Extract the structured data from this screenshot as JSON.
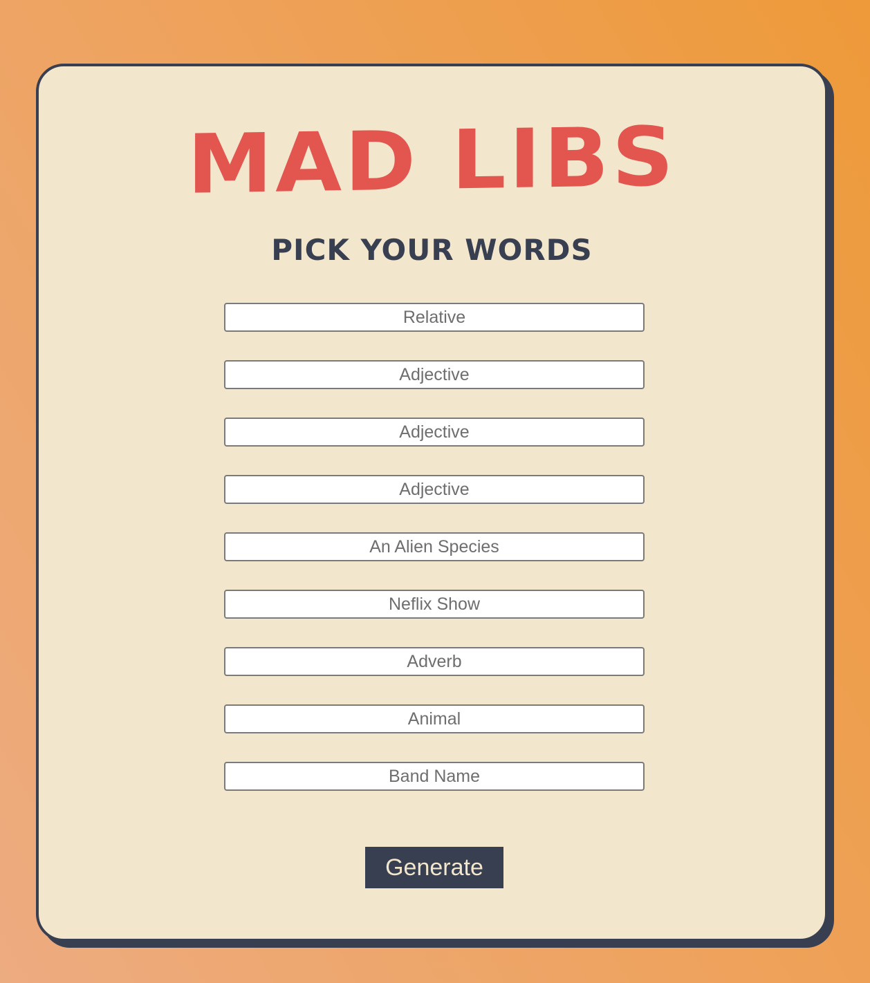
{
  "header": {
    "title": "MAD LIBS",
    "subtitle": "PICK YOUR WORDS"
  },
  "form": {
    "fields": [
      {
        "placeholder": "Relative",
        "value": ""
      },
      {
        "placeholder": "Adjective",
        "value": ""
      },
      {
        "placeholder": "Adjective",
        "value": ""
      },
      {
        "placeholder": "Adjective",
        "value": ""
      },
      {
        "placeholder": "An Alien Species",
        "value": ""
      },
      {
        "placeholder": "Neflix Show",
        "value": ""
      },
      {
        "placeholder": "Adverb",
        "value": ""
      },
      {
        "placeholder": "Animal",
        "value": ""
      },
      {
        "placeholder": "Band Name",
        "value": ""
      }
    ],
    "submit_label": "Generate"
  },
  "colors": {
    "background_gradient_start": "#edab80",
    "background_gradient_end": "#ee9a3a",
    "card": "#f2e6cc",
    "card_border": "#383f51",
    "title": "#e3554f",
    "subtitle": "#383f51",
    "button_bg": "#383f51",
    "button_text": "#f2e6cc"
  }
}
